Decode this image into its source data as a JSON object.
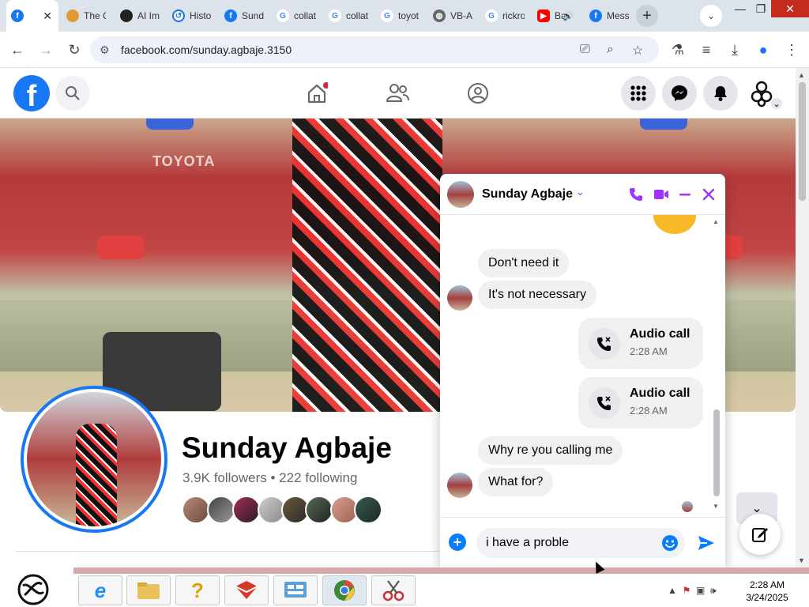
{
  "browser": {
    "tabs": [
      {
        "label": "",
        "favicon": "facebook-icon",
        "active": true
      },
      {
        "label": "The C",
        "favicon": "generic-icon"
      },
      {
        "label": "AI Im",
        "favicon": "generic-icon"
      },
      {
        "label": "Histo",
        "favicon": "history-icon"
      },
      {
        "label": "Sund",
        "favicon": "facebook-icon"
      },
      {
        "label": "collat",
        "favicon": "google-icon"
      },
      {
        "label": "collat",
        "favicon": "google-icon"
      },
      {
        "label": "toyot",
        "favicon": "google-icon"
      },
      {
        "label": "VB-A",
        "favicon": "globe-icon"
      },
      {
        "label": "rickro",
        "favicon": "google-icon"
      },
      {
        "label": "Ba",
        "favicon": "youtube-icon"
      },
      {
        "label": "Mess",
        "favicon": "facebook-icon"
      }
    ],
    "new_tab": "+",
    "url": "facebook.com/sunday.agbaje.3150"
  },
  "facebook": {
    "logo": "f",
    "profile": {
      "name": "Sunday Agbaje",
      "stats": "3.9K followers • 222 following"
    }
  },
  "chat": {
    "name": "Sunday Agbaje",
    "messages": [
      {
        "text": "Don't need it"
      },
      {
        "text": "It's not necessary"
      },
      {
        "text": "Why re you calling me"
      },
      {
        "text": "What for?"
      }
    ],
    "calls": [
      {
        "title": "Audio call",
        "time": "2:28 AM"
      },
      {
        "title": "Audio call",
        "time": "2:28 AM"
      }
    ],
    "input_value": "i have a proble"
  },
  "taskbar": {
    "time": "2:28 AM",
    "date": "3/24/2025"
  },
  "colors": {
    "facebook_blue": "#1877f2",
    "messenger_purple": "#a033ff",
    "messenger_blue": "#0a7cff"
  }
}
